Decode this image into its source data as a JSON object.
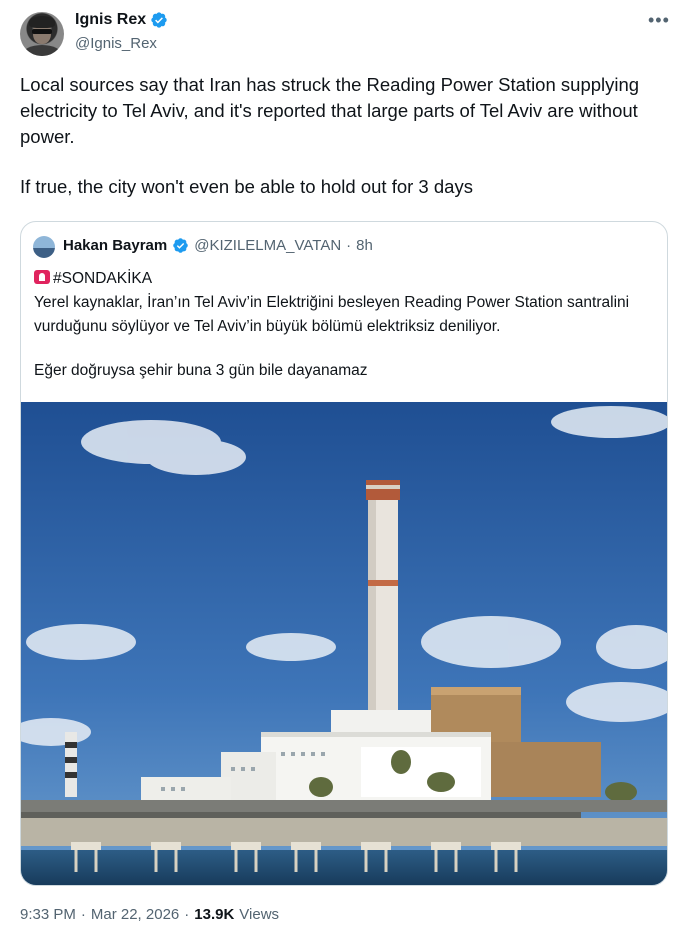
{
  "author": {
    "name": "Ignis Rex",
    "handle": "@Ignis_Rex",
    "verified": true
  },
  "tweet": {
    "paragraphs": [
      "Local sources say that Iran has struck the Reading Power Station supplying electricity to Tel Aviv, and it's reported that large parts of Tel Aviv are without power.",
      "If true, the city won't even be able to hold out for 3 days"
    ]
  },
  "quote": {
    "name": "Hakan Bayram",
    "handle": "@KIZILELMA_VATAN",
    "separator": "·",
    "time": "8h",
    "hashtag": "#SONDAKİKA",
    "line1": "Yerel kaynaklar, İran’ın Tel Aviv’in Elektriğini besleyen Reading Power Station santralini vurduğunu söylüyor ve Tel Aviv’in büyük bölümü elektriksiz deniliyor.",
    "line2": "Eğer doğruysa şehir buna 3 gün bile dayanamaz"
  },
  "meta": {
    "time": "9:33 PM",
    "sep1": "·",
    "date": "Mar 22, 2026",
    "sep2": "·",
    "views_count": "13.9K",
    "views_label": "Views"
  },
  "icons": {
    "more": "more-options-icon",
    "verified": "verified-badge-icon",
    "siren": "siren-emoji-icon"
  },
  "colors": {
    "verified": "#1d9bf0",
    "secondary_text": "#536471",
    "border": "#cfd9de",
    "siren": "#e0245e"
  }
}
